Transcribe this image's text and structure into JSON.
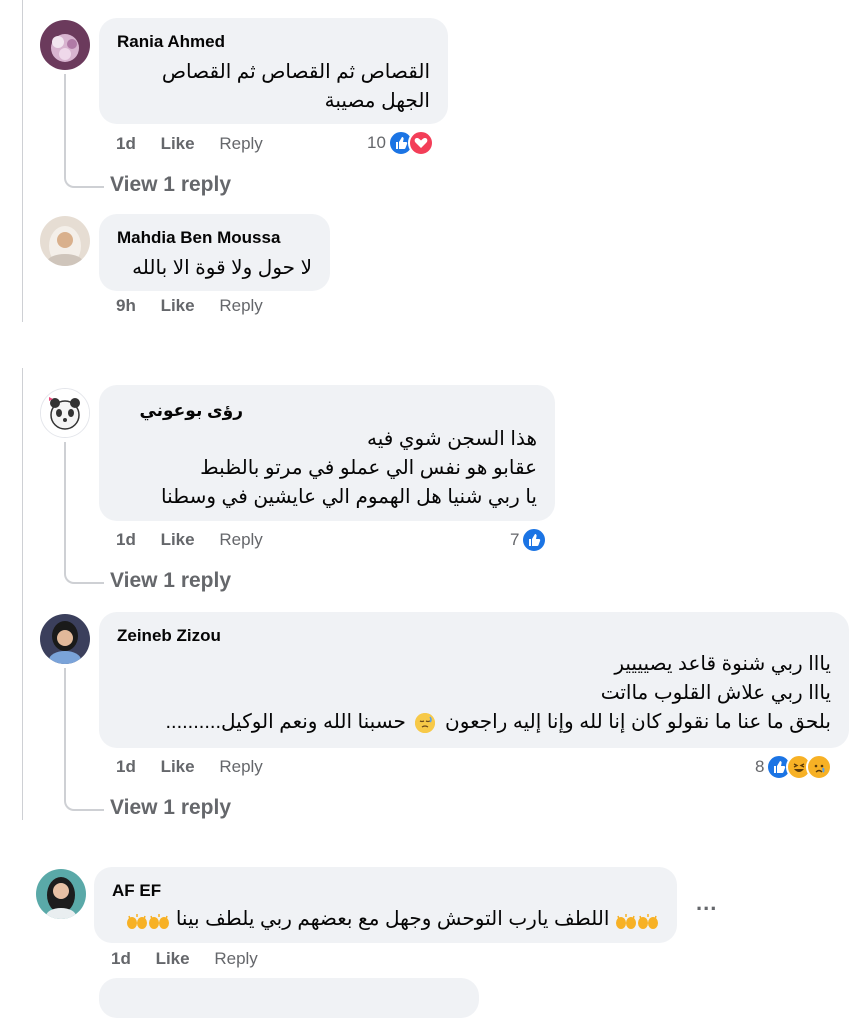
{
  "comments": [
    {
      "author": "Rania Ahmed",
      "lines": [
        "القصاص ثم القصاص ثم القصاص",
        "الجهل مصيبة"
      ],
      "time": "1d",
      "like": "Like",
      "reply": "Reply",
      "reaction_count": "10",
      "reactions": [
        "like-icon",
        "love-icon"
      ],
      "view_replies": "View 1 reply"
    },
    {
      "author": "Mahdia Ben Moussa",
      "lines": [
        "لا حول ولا قوة الا بالله"
      ],
      "time": "9h",
      "like": "Like",
      "reply": "Reply"
    },
    {
      "author": "رؤى بوعوني",
      "lines": [
        "هذا السجن شوي فيه",
        "عقابو هو نفس الي عملو في مرتو بالظبط",
        "يا ربي شنيا هل الهموم الي عايشين في وسطنا"
      ],
      "time": "1d",
      "like": "Like",
      "reply": "Reply",
      "reaction_count": "7",
      "reactions": [
        "like-icon"
      ],
      "view_replies": "View 1 reply"
    },
    {
      "author": "Zeineb Zizou",
      "lines": [
        "يااا ربي شنوة قاعد يصيييير",
        "يااا ربي علاش القلوب مااتت",
        "بلحق ما عنا ما نقولو كان إنا لله وإنا إليه راجعون",
        "حسبنا الله ونعم الوكيل.........."
      ],
      "time": "1d",
      "like": "Like",
      "reply": "Reply",
      "reaction_count": "8",
      "reactions": [
        "like-icon",
        "haha-icon",
        "sad-icon"
      ],
      "view_replies": "View 1 reply"
    },
    {
      "author": "AF EF",
      "lines": [
        "اللطف يارب التوحش وجهل مع بعضهم ربي يلطف بينا"
      ],
      "time": "1d",
      "like": "Like",
      "reply": "Reply",
      "more": "..."
    }
  ],
  "colors": {
    "bubble": "#f0f2f5",
    "meta": "#65676b",
    "like_blue": "#1b74e4",
    "love_red": "#f33e58",
    "emoji_yellow": "#f7b125"
  }
}
